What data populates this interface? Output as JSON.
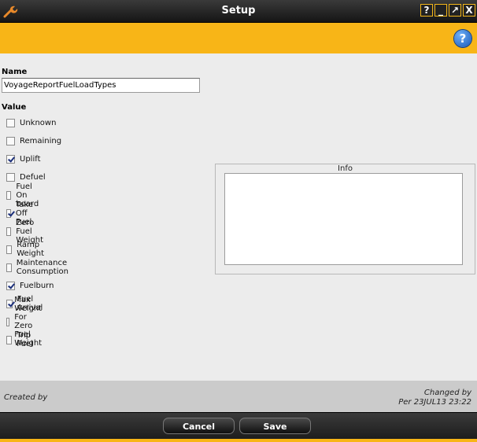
{
  "window": {
    "title": "Setup",
    "app_icon": "wrench-icon"
  },
  "window_buttons": [
    {
      "label": "?"
    },
    {
      "label": "_"
    },
    {
      "label": "↗"
    },
    {
      "label": "X"
    }
  ],
  "toolbar": {
    "help_label": "?"
  },
  "form": {
    "name_label": "Name",
    "name_value": "VoyageReportFuelLoadTypes",
    "value_label": "Value",
    "values": [
      {
        "label": "Unknown",
        "checked": false
      },
      {
        "label": "Remaining",
        "checked": false
      },
      {
        "label": "Uplift",
        "checked": true
      },
      {
        "label": "Defuel",
        "checked": false
      },
      {
        "label": "Fuel On board",
        "checked": false
      },
      {
        "label": "Take Off Fuel",
        "checked": true
      },
      {
        "label": "Zero Fuel Weight",
        "checked": false
      },
      {
        "label": "Ramp Weight",
        "checked": false
      },
      {
        "label": "Maintenance Consumption",
        "checked": false
      },
      {
        "label": "Fuelburn",
        "checked": true
      },
      {
        "label": "Fuel Arrival",
        "checked": true
      },
      {
        "label": "Max Weight For Zero Fuel Weight",
        "checked": false
      },
      {
        "label": "Trip Fuel",
        "checked": false
      }
    ],
    "info_label": "Info",
    "info_value": ""
  },
  "footer": {
    "created_by": "Created by",
    "changed_by": "Changed by",
    "changed_detail": "Per 23JUL13 23:22"
  },
  "actions": {
    "cancel_label": "Cancel",
    "save_label": "Save"
  },
  "colors": {
    "accent": "#f8b517",
    "titlebar": "#1f1f1f",
    "panel": "#ececec",
    "footer": "#cbcbcb"
  }
}
